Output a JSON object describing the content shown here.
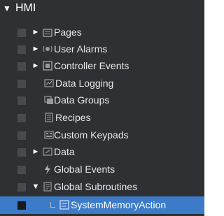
{
  "tree": {
    "root": {
      "label": "HMI",
      "toggle": "▼"
    },
    "items": [
      {
        "label": "Pages",
        "toggle": "►",
        "icon": "pages-icon",
        "selected": false
      },
      {
        "label": "User Alarms",
        "toggle": "►",
        "icon": "user-alarms-icon",
        "selected": false
      },
      {
        "label": "Controller Events",
        "toggle": "►",
        "icon": "controller-events-icon",
        "selected": false
      },
      {
        "label": "Data Logging",
        "toggle": "",
        "icon": "data-logging-icon",
        "selected": false
      },
      {
        "label": "Data Groups",
        "toggle": "",
        "icon": "data-groups-icon",
        "selected": false
      },
      {
        "label": "Recipes",
        "toggle": "",
        "icon": "recipes-icon",
        "selected": false
      },
      {
        "label": "Custom Keypads",
        "toggle": "",
        "icon": "custom-keypads-icon",
        "selected": false
      },
      {
        "label": "Data",
        "toggle": "►",
        "icon": "data-icon",
        "selected": false
      },
      {
        "label": "Global Events",
        "toggle": "",
        "icon": "lightning-icon",
        "selected": false
      },
      {
        "label": "Global Subroutines",
        "toggle": "▼",
        "icon": "global-subroutines-icon",
        "selected": false
      },
      {
        "label": "SystemMemoryAction",
        "toggle": "",
        "icon": "system-memory-action-icon",
        "selected": true
      }
    ]
  },
  "colors": {
    "panel_background": "#2f3033",
    "selected_background": "#3b7bc8",
    "text": "#e6e6e6",
    "icon_gray": "#9a9a9a"
  }
}
